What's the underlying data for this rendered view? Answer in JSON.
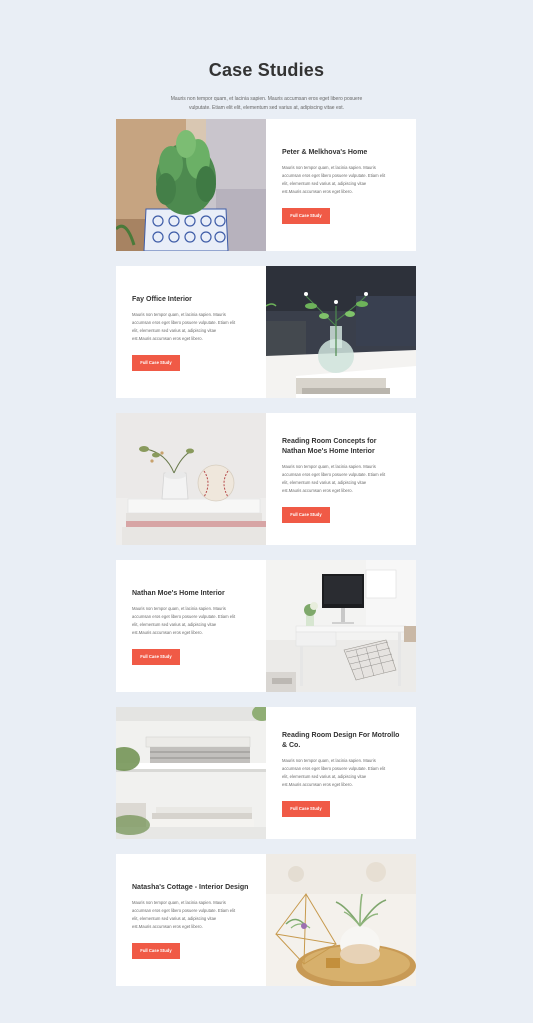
{
  "header": {
    "title": "Case Studies",
    "intro_line1": "Mauris non tempor quam, et lacinia sapien. Mauris accumsan eros eget libero posuere",
    "intro_line2": "vulputate. Etiam elit elit, elementum sed varius at, adipiscing vitae est."
  },
  "common": {
    "body_line1": "Mauris non tempor quam, et lacinia sapien. Mauris",
    "body_line2": "accumsan eros eget libero posuere vulputate. Etiam elit",
    "body_line3": "elit, elementum sed varius at, adipiscing vitae",
    "body_line4": "est.Mauris accumsan eros eget libero.",
    "cta_label": "Full Case Study"
  },
  "cards": [
    {
      "title": "Peter & Melkhova's Home",
      "image": "potted-cactus"
    },
    {
      "title": "Fay Office Interior",
      "image": "glass-vase-flowers"
    },
    {
      "title": "Reading Room Concepts for Nathan Moe's Home Interior",
      "image": "books-baseball"
    },
    {
      "title": "Nathan Moe's Home Interior",
      "image": "white-desk-monitor"
    },
    {
      "title": "Reading Room Design For Motrollo & Co.",
      "image": "bookshelf"
    },
    {
      "title": "Natasha's Cottage - Interior Design",
      "image": "air-plants-tray"
    }
  ],
  "colors": {
    "background": "#e9eef5",
    "accent": "#f05a46",
    "card": "#ffffff",
    "title": "#333333"
  }
}
